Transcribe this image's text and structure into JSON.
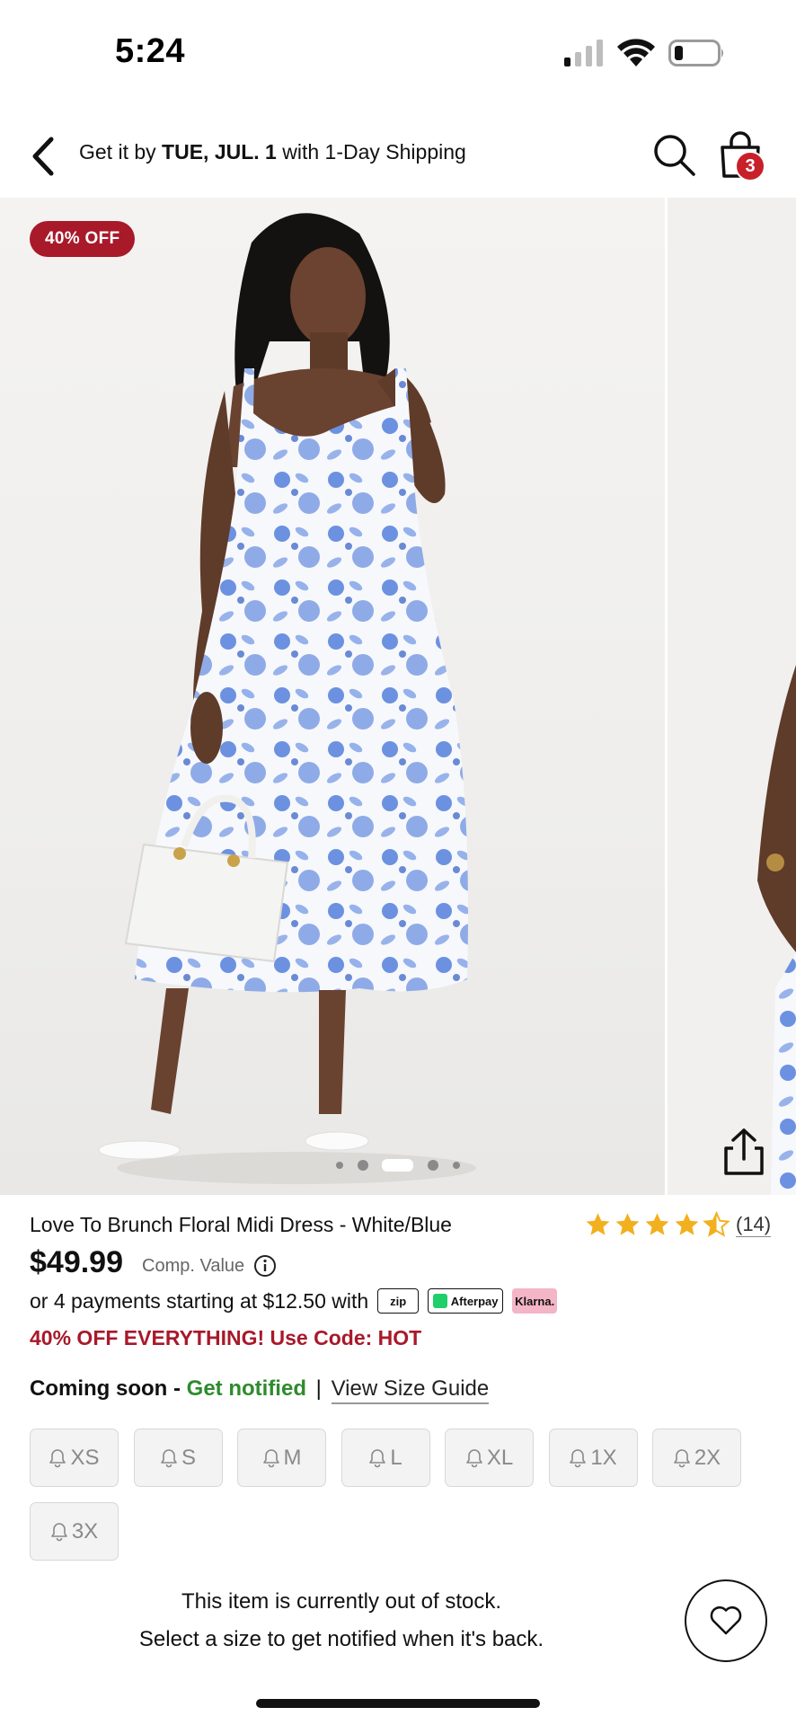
{
  "status_bar": {
    "time": "5:24"
  },
  "header": {
    "shipping_prefix": "Get it by ",
    "shipping_date": "TUE, JUL. 1",
    "shipping_suffix": " with 1-Day Shipping",
    "bag_count": "3"
  },
  "gallery": {
    "discount_badge": "40% OFF",
    "image_count": 5,
    "active_image_index": 2
  },
  "product": {
    "title": "Love To Brunch Floral Midi Dress - White/Blue",
    "rating": 4.5,
    "review_count": "(14)",
    "price": "$49.99",
    "comp_value_label": "Comp. Value",
    "installments_text": "or 4 payments starting at $12.50 with",
    "payment_providers": [
      "zip",
      "Afterpay",
      "Klarna."
    ],
    "promo": "40% OFF EVERYTHING! Use Code: HOT"
  },
  "availability": {
    "coming_soon": "Coming soon",
    "dash": " - ",
    "get_notified": "Get notified",
    "separator": "|",
    "size_guide": "View Size Guide"
  },
  "sizes": [
    "XS",
    "S",
    "M",
    "L",
    "XL",
    "1X",
    "2X",
    "3X"
  ],
  "out_of_stock": {
    "line1": "This item is currently out of stock.",
    "line2": "Select a size to get notified when it's back."
  },
  "colors": {
    "badge_red": "#a8192a",
    "promo_red": "#a8192a",
    "notify_green": "#2e8b2e",
    "star_gold": "#f2b01e",
    "bag_badge": "#c8202a"
  },
  "icons": [
    "back-chevron-icon",
    "search-icon",
    "shopping-bag-icon",
    "share-icon",
    "info-icon",
    "bell-icon",
    "heart-icon",
    "star-icon"
  ]
}
